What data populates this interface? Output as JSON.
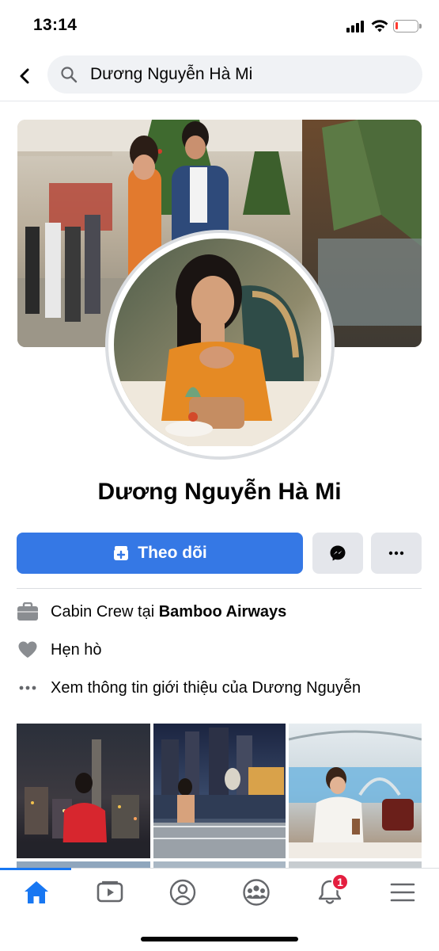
{
  "status_bar": {
    "time": "13:14"
  },
  "search": {
    "query": "Dương Nguyễn Hà Mi",
    "icon": "search-icon"
  },
  "profile": {
    "name": "Dương Nguyễn Hà Mi"
  },
  "actions": {
    "follow_label": "Theo dõi",
    "messenger_icon": "messenger-icon",
    "more_icon": "more-icon"
  },
  "intro": {
    "work_prefix": "Cabin Crew tại ",
    "work_place": "Bamboo Airways",
    "relationship": "Hẹn hò",
    "see_about": "Xem thông tin giới thiệu của Dương Nguyễn"
  },
  "photos": [
    "night-city-photo",
    "marina-bay-photo",
    "mall-cafe-photo"
  ],
  "tab_bar": {
    "tabs": [
      "home-icon",
      "watch-icon",
      "profile-icon",
      "groups-icon",
      "notifications-icon",
      "menu-icon"
    ],
    "notifications_badge": "1",
    "accent": "#1877f2"
  },
  "colors": {
    "primary_button": "#3578e5",
    "secondary_button": "#e4e6eb",
    "badge": "#e41e3f"
  }
}
